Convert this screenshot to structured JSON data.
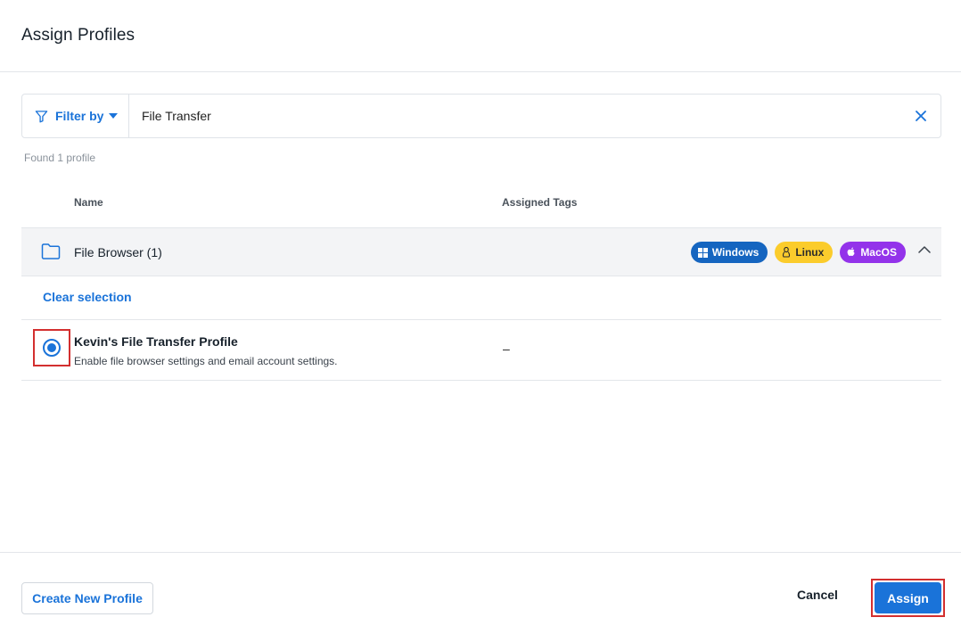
{
  "dialog": {
    "title": "Assign Profiles"
  },
  "filter": {
    "label": "Filter by",
    "value": "File Transfer",
    "icons": {
      "filter": "filter-icon",
      "caret": "caret-down-icon",
      "clear": "close-icon"
    }
  },
  "results": {
    "count_text": "Found 1 profile"
  },
  "columns": {
    "name": "Name",
    "tags": "Assigned Tags"
  },
  "group": {
    "name": "File Browser (1)",
    "badges": [
      {
        "label": "Windows",
        "icon": "windows-icon",
        "color": "#1565c0"
      },
      {
        "label": "Linux",
        "icon": "linux-icon",
        "color": "#fbcc2c"
      },
      {
        "label": "MacOS",
        "icon": "apple-icon",
        "color": "#9333ea"
      }
    ],
    "expanded": true
  },
  "selection": {
    "clear_label": "Clear selection"
  },
  "profiles": [
    {
      "name": "Kevin's File Transfer Profile",
      "description": "Enable file browser settings and email account settings.",
      "assigned_tags": "–",
      "selected": true
    }
  ],
  "footer": {
    "create_label": "Create New Profile",
    "cancel_label": "Cancel",
    "assign_label": "Assign"
  },
  "colors": {
    "accent": "#1a73d9",
    "highlight": "#d32f2f"
  }
}
